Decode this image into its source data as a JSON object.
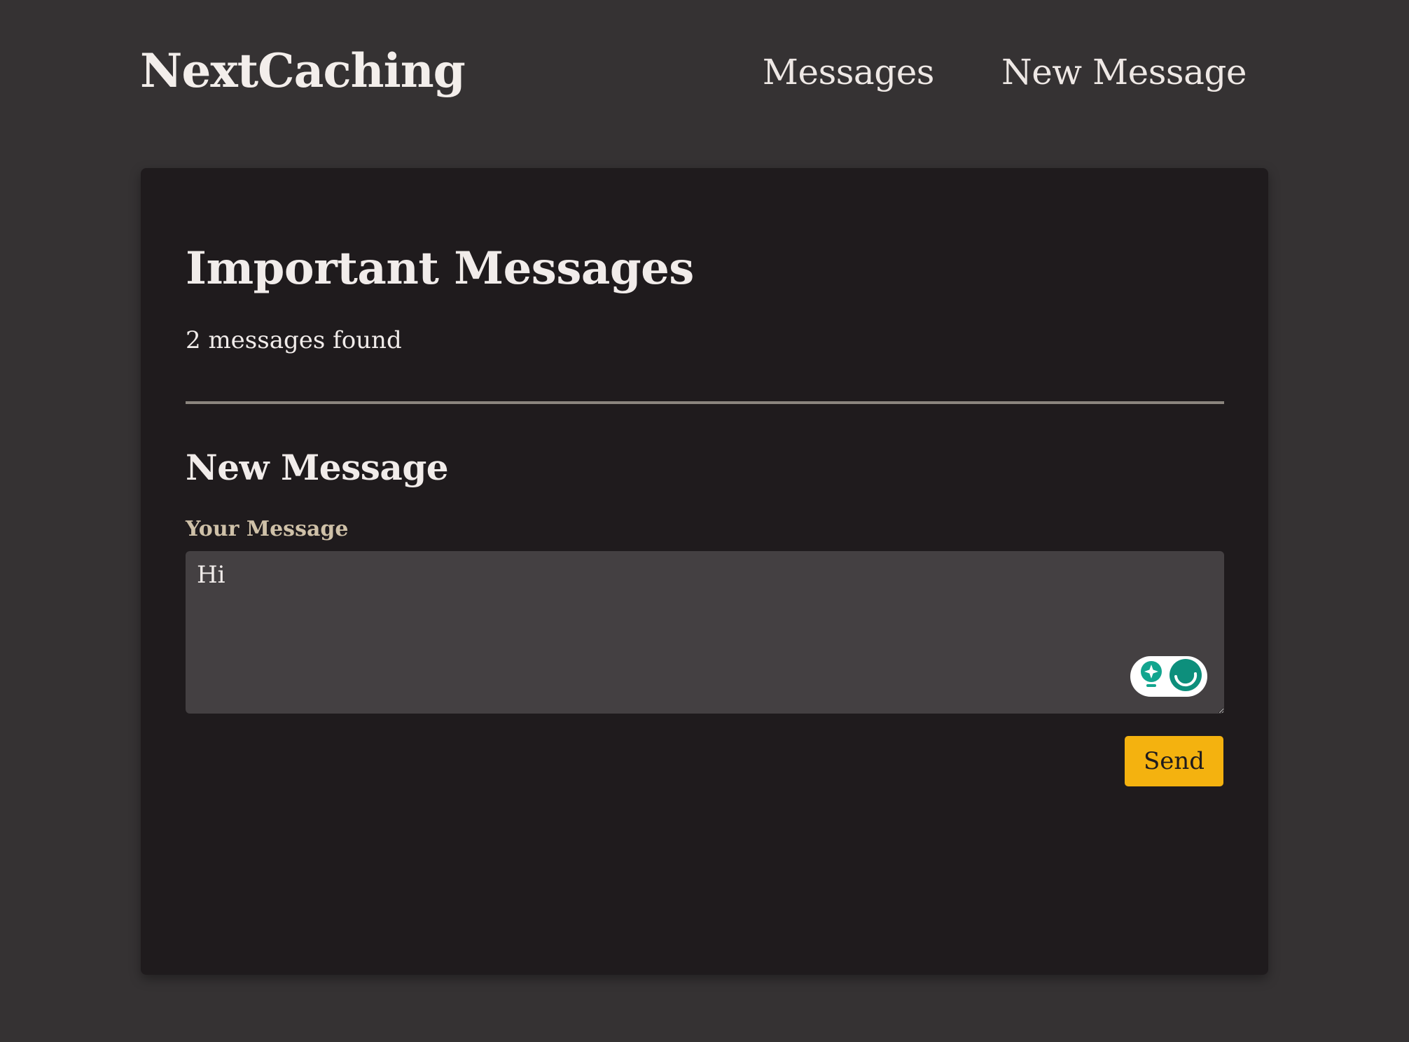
{
  "header": {
    "logo": "NextCaching",
    "nav": [
      {
        "label": "Messages"
      },
      {
        "label": "New Message"
      }
    ]
  },
  "main": {
    "title": "Important Messages",
    "count_text": "2 messages found",
    "form": {
      "heading": "New Message",
      "field_label": "Your Message",
      "textarea_value": "Hi",
      "submit_label": "Send"
    }
  },
  "colors": {
    "page_bg": "#353233",
    "card_bg": "#1f1b1d",
    "accent": "#f4b20f",
    "label": "#cfc1a8",
    "input_bg": "#444042",
    "widget_teal": "#0d8f7c"
  },
  "icons": {
    "grammar_widget": [
      "lightbulb-sparkle-icon",
      "grammar-assistant-icon"
    ]
  }
}
